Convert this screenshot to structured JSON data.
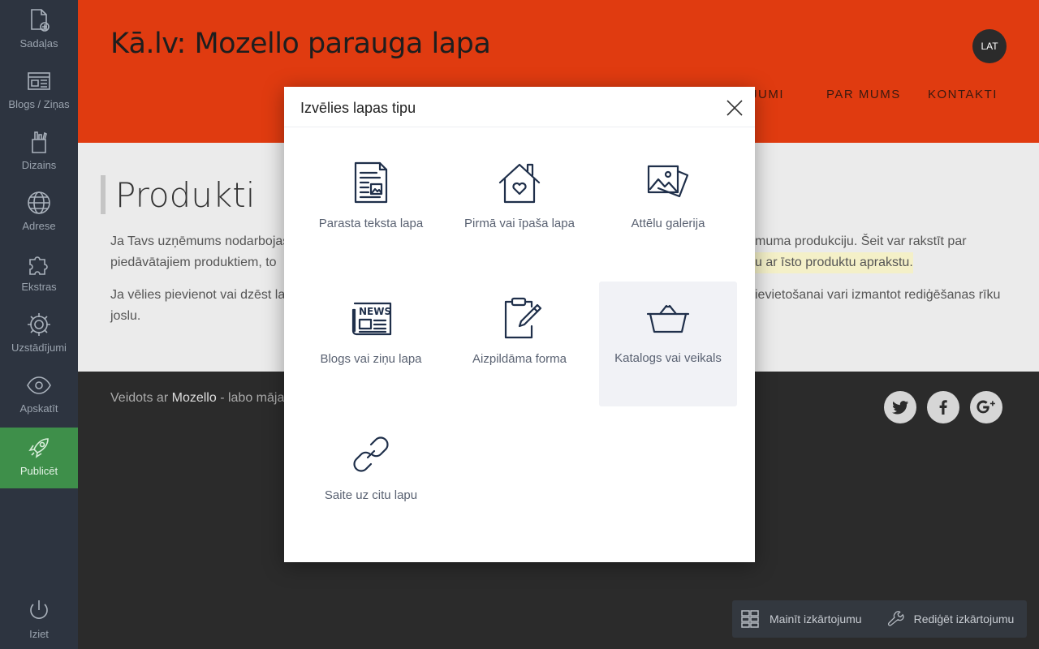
{
  "sidebar": {
    "items": [
      {
        "label": "Sadaļas",
        "icon": "add-page-icon"
      },
      {
        "label": "Blogs / Ziņas",
        "icon": "blog-icon"
      },
      {
        "label": "Dizains",
        "icon": "design-icon"
      },
      {
        "label": "Adrese",
        "icon": "globe-icon"
      },
      {
        "label": "Ekstras",
        "icon": "puzzle-icon"
      },
      {
        "label": "Uzstādījumi",
        "icon": "gear-icon"
      },
      {
        "label": "Apskatīt",
        "icon": "eye-icon"
      },
      {
        "label": "Publicēt",
        "icon": "rocket-icon"
      }
    ],
    "logout_label": "Iziet"
  },
  "site": {
    "title": "Kā.lv: Mozello parauga lapa",
    "lang": "LAT",
    "nav": [
      "JUMI",
      "PAR MUMS",
      "KONTAKTI"
    ]
  },
  "content": {
    "heading": "Produkti",
    "para1_left": "Ja Tavs uzņēmums nodarbojas",
    "para1_right": "muma produkciju. Šeit var rakstīt par",
    "para2_left": "piedāvātajiem produktiem, to",
    "para2_right": "u ar īsto produktu aprakstu.",
    "para3_left": "Ja vēlies pievienot vai dzēst lap",
    "para3_right": "ievietošanai vari izmantot rediģēšanas rīku",
    "para4_left": "joslu."
  },
  "footer": {
    "prefix": "Veidots ar ",
    "brand": "Mozello",
    "suffix": " - labo māja",
    "social": [
      "twitter-icon",
      "facebook-icon",
      "google-plus-icon"
    ]
  },
  "modal": {
    "title": "Izvēlies lapas tipu",
    "types": [
      {
        "label": "Parasta teksta lapa",
        "icon": "text-page-icon"
      },
      {
        "label": "Pirmā vai īpaša lapa",
        "icon": "home-heart-icon"
      },
      {
        "label": "Attēlu galerija",
        "icon": "gallery-icon"
      },
      {
        "label": "Blogs vai ziņu lapa",
        "icon": "news-icon"
      },
      {
        "label": "Aizpildāma forma",
        "icon": "form-icon"
      },
      {
        "label": "Katalogs vai veikals",
        "icon": "basket-icon"
      },
      {
        "label": "Saite uz citu lapu",
        "icon": "link-icon"
      }
    ],
    "news_icon_text": "NEWS"
  },
  "toolbar": {
    "change_layout": "Mainīt izkārtojumu",
    "edit_layout": "Rediģēt izkārtojumu"
  },
  "colors": {
    "header": "#e03b10",
    "sidebar": "#2d3440",
    "publish": "#3e8f4a",
    "footer": "#2b2b2b"
  }
}
